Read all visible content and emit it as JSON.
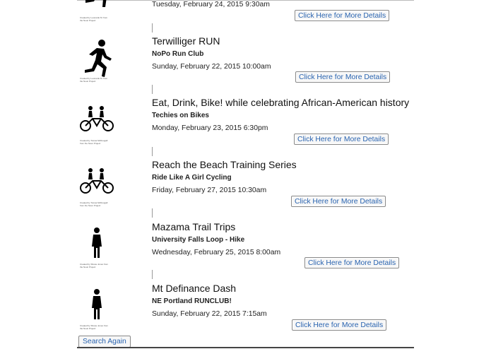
{
  "events": [
    {
      "date": "Tuesday, February 24, 2015 9:30am",
      "button": "Click Here for More Details",
      "icon": "runner-icon",
      "credit": "Created by Leonardo M. from the Noun Project"
    },
    {
      "title": "Terwilliger RUN",
      "org": "NoPo Run Club",
      "date": "Sunday, February 22, 2015 10:00am",
      "button": "Click Here for More Details",
      "icon": "runner-icon",
      "credit": "Created by Leonardo M. from the Noun Project"
    },
    {
      "title": "Eat, Drink, Bike! while celebrating African-American history",
      "org": "Techies on Bikes",
      "date": "Monday, February 23, 2015 6:30pm",
      "button": "Click Here for More Details",
      "icon": "tandem-bicycle-icon",
      "credit": "Created by Tomas McDougall from the Noun Project"
    },
    {
      "title": "Reach the Beach Training Series",
      "org": "Ride Like A Girl Cycling",
      "date": "Friday, February 27, 2015 10:30am",
      "button": "Click Here for More Details",
      "icon": "tandem-bicycle-icon",
      "credit": "Created by Tomas McDougall from the Noun Project"
    },
    {
      "title": "Mazama Trail Trips",
      "org": "University Falls Loop - Hike",
      "date": "Wednesday, February 25, 2015 8:00am",
      "button": "Click Here for More Details",
      "icon": "hiker-icon",
      "credit": "Created by Shane Jones from the Noun Project"
    },
    {
      "title": "Mt Definance Dash",
      "org": "NE Portland RUNCLUB!",
      "date": "Sunday, February 22, 2015 7:15am",
      "button": "Click Here for More Details",
      "icon": "hiker-icon",
      "credit": "Created by Shane Jones from the Noun Project"
    }
  ],
  "search_again": "Search Again"
}
